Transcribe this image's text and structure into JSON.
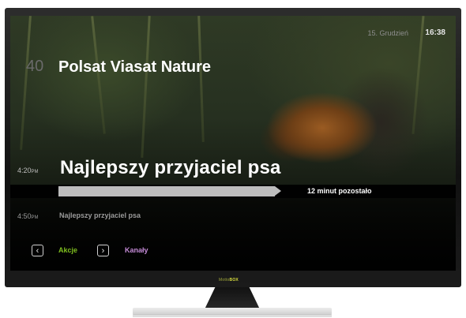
{
  "header": {
    "date": "15. Grudzień",
    "time": "16:38"
  },
  "channel": {
    "number": "40",
    "name": "Polsat Viasat Nature"
  },
  "current": {
    "start_time": "4:20",
    "ampm": "PM",
    "title": "Najlepszy przyjaciel psa",
    "remaining": "12 minut pozostało",
    "progress": 0.55
  },
  "next": {
    "start_time": "4:50",
    "ampm": "PM",
    "title": "Najlepszy przyjaciel psa"
  },
  "nav": {
    "prev_icon": "chevron-left-icon",
    "actions_label": "Akcje",
    "next_icon": "chevron-right-icon",
    "channels_label": "Kanały"
  },
  "brand": {
    "prefix": "Motto",
    "suffix": "BOX"
  },
  "colors": {
    "accent_green": "#7fbf1f",
    "accent_purple": "#c48bd6",
    "progress": "#bdbdbd"
  }
}
